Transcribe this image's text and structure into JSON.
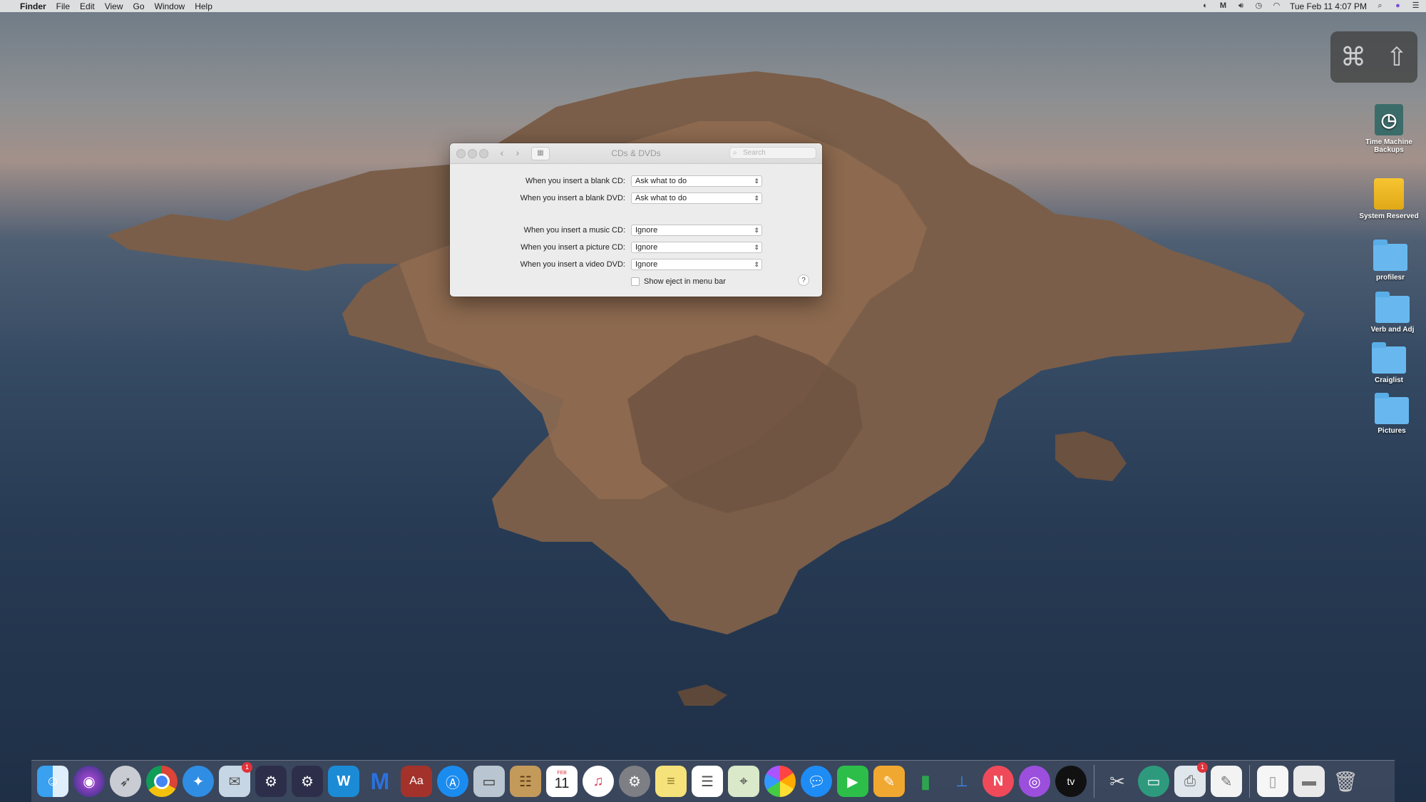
{
  "menubar": {
    "app_name": "Finder",
    "menus": [
      "File",
      "Edit",
      "View",
      "Go",
      "Window",
      "Help"
    ],
    "clock": "Tue Feb 11  4:07 PM"
  },
  "window": {
    "title": "CDs & DVDs",
    "search_placeholder": "Search",
    "rows": [
      {
        "label": "When you insert a blank CD:",
        "value": "Ask what to do"
      },
      {
        "label": "When you insert a blank DVD:",
        "value": "Ask what to do"
      },
      {
        "label": "When you insert a music CD:",
        "value": "Ignore"
      },
      {
        "label": "When you insert a picture CD:",
        "value": "Ignore"
      },
      {
        "label": "When you insert a video DVD:",
        "value": "Ignore"
      }
    ],
    "eject_label": "Show eject in menu bar",
    "eject_checked": false,
    "help": "?"
  },
  "desktop_icons": [
    {
      "label": "Time Machine Backups",
      "icon": "time-machine-icon"
    },
    {
      "label": "System Reserved",
      "icon": "drive-icon"
    },
    {
      "label": "profilesr",
      "icon": "folder-icon"
    },
    {
      "label": "Verb and Adj",
      "icon": "folder-icon"
    },
    {
      "label": "Craiglist",
      "icon": "folder-icon"
    },
    {
      "label": "Pictures",
      "icon": "folder-icon"
    }
  ],
  "dock": {
    "calendar_month": "FEB",
    "calendar_day": "11",
    "dictionary_glyph": "Aa",
    "appletv_label": "tv",
    "badges": {
      "app5": "1",
      "app_right": "1"
    }
  }
}
